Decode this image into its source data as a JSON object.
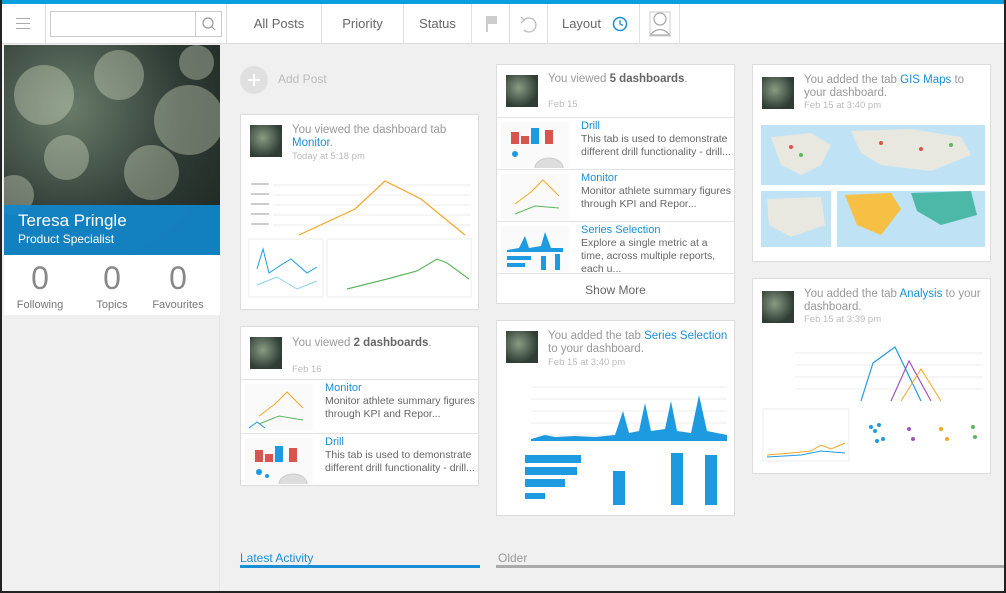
{
  "search": {
    "placeholder": "",
    "value": ""
  },
  "nav": {
    "all_posts": "All Posts",
    "priority": "Priority",
    "status": "Status",
    "layout": "Layout"
  },
  "profile": {
    "name": "Teresa Pringle",
    "role": "Product Specialist",
    "stats": [
      {
        "value": "0",
        "label": "Following"
      },
      {
        "value": "0",
        "label": "Topics"
      },
      {
        "value": "0",
        "label": "Favourites"
      }
    ]
  },
  "add_post": "Add Post",
  "cards": {
    "monitor_tab": {
      "pre": "You viewed the dashboard tab",
      "link": "Monitor",
      "post": ".",
      "time": "Today at 5:18 pm"
    },
    "two_dash": {
      "pre": "You viewed ",
      "count": "2 dashboards",
      "post": ".",
      "time": "Feb 16",
      "items": [
        {
          "title": "Monitor",
          "desc": "Monitor athlete summary figures through KPI and Repor..."
        },
        {
          "title": "Drill",
          "desc": "This tab is used to demonstrate different drill functionality - drill..."
        }
      ]
    },
    "five_dash": {
      "pre": "You viewed ",
      "count": "5 dashboards",
      "post": ".",
      "time": "Feb 15",
      "items": [
        {
          "title": "Drill",
          "desc": "This tab is used to demonstrate different drill functionality - drill..."
        },
        {
          "title": "Monitor",
          "desc": "Monitor athlete summary figures through KPI and Repor..."
        },
        {
          "title": "Series Selection",
          "desc": "Explore a single metric at a time, across multiple reports, each u..."
        }
      ],
      "show_more": "Show More"
    },
    "series_sel": {
      "pre": "You added the tab ",
      "link": "Series Selection",
      "post": " to your dashboard.",
      "time": "Feb 15 at 3:40 pm"
    },
    "gis": {
      "pre": "You added the tab ",
      "link": "GIS Maps",
      "post": " to your dashboard.",
      "time": "Feb 15 at 3:40 pm"
    },
    "analysis": {
      "pre": "You added the tab ",
      "link": "Analysis",
      "post": " to your dashboard.",
      "time": "Feb 15 at 3:39 pm"
    }
  },
  "tabs": {
    "latest": "Latest Activity",
    "older": "Older"
  },
  "colors": {
    "accent": "#1a8fd6",
    "topline": "#0aa0e0",
    "orange": "#f5a623",
    "green": "#5cb85c",
    "blue": "#1e9be0"
  }
}
